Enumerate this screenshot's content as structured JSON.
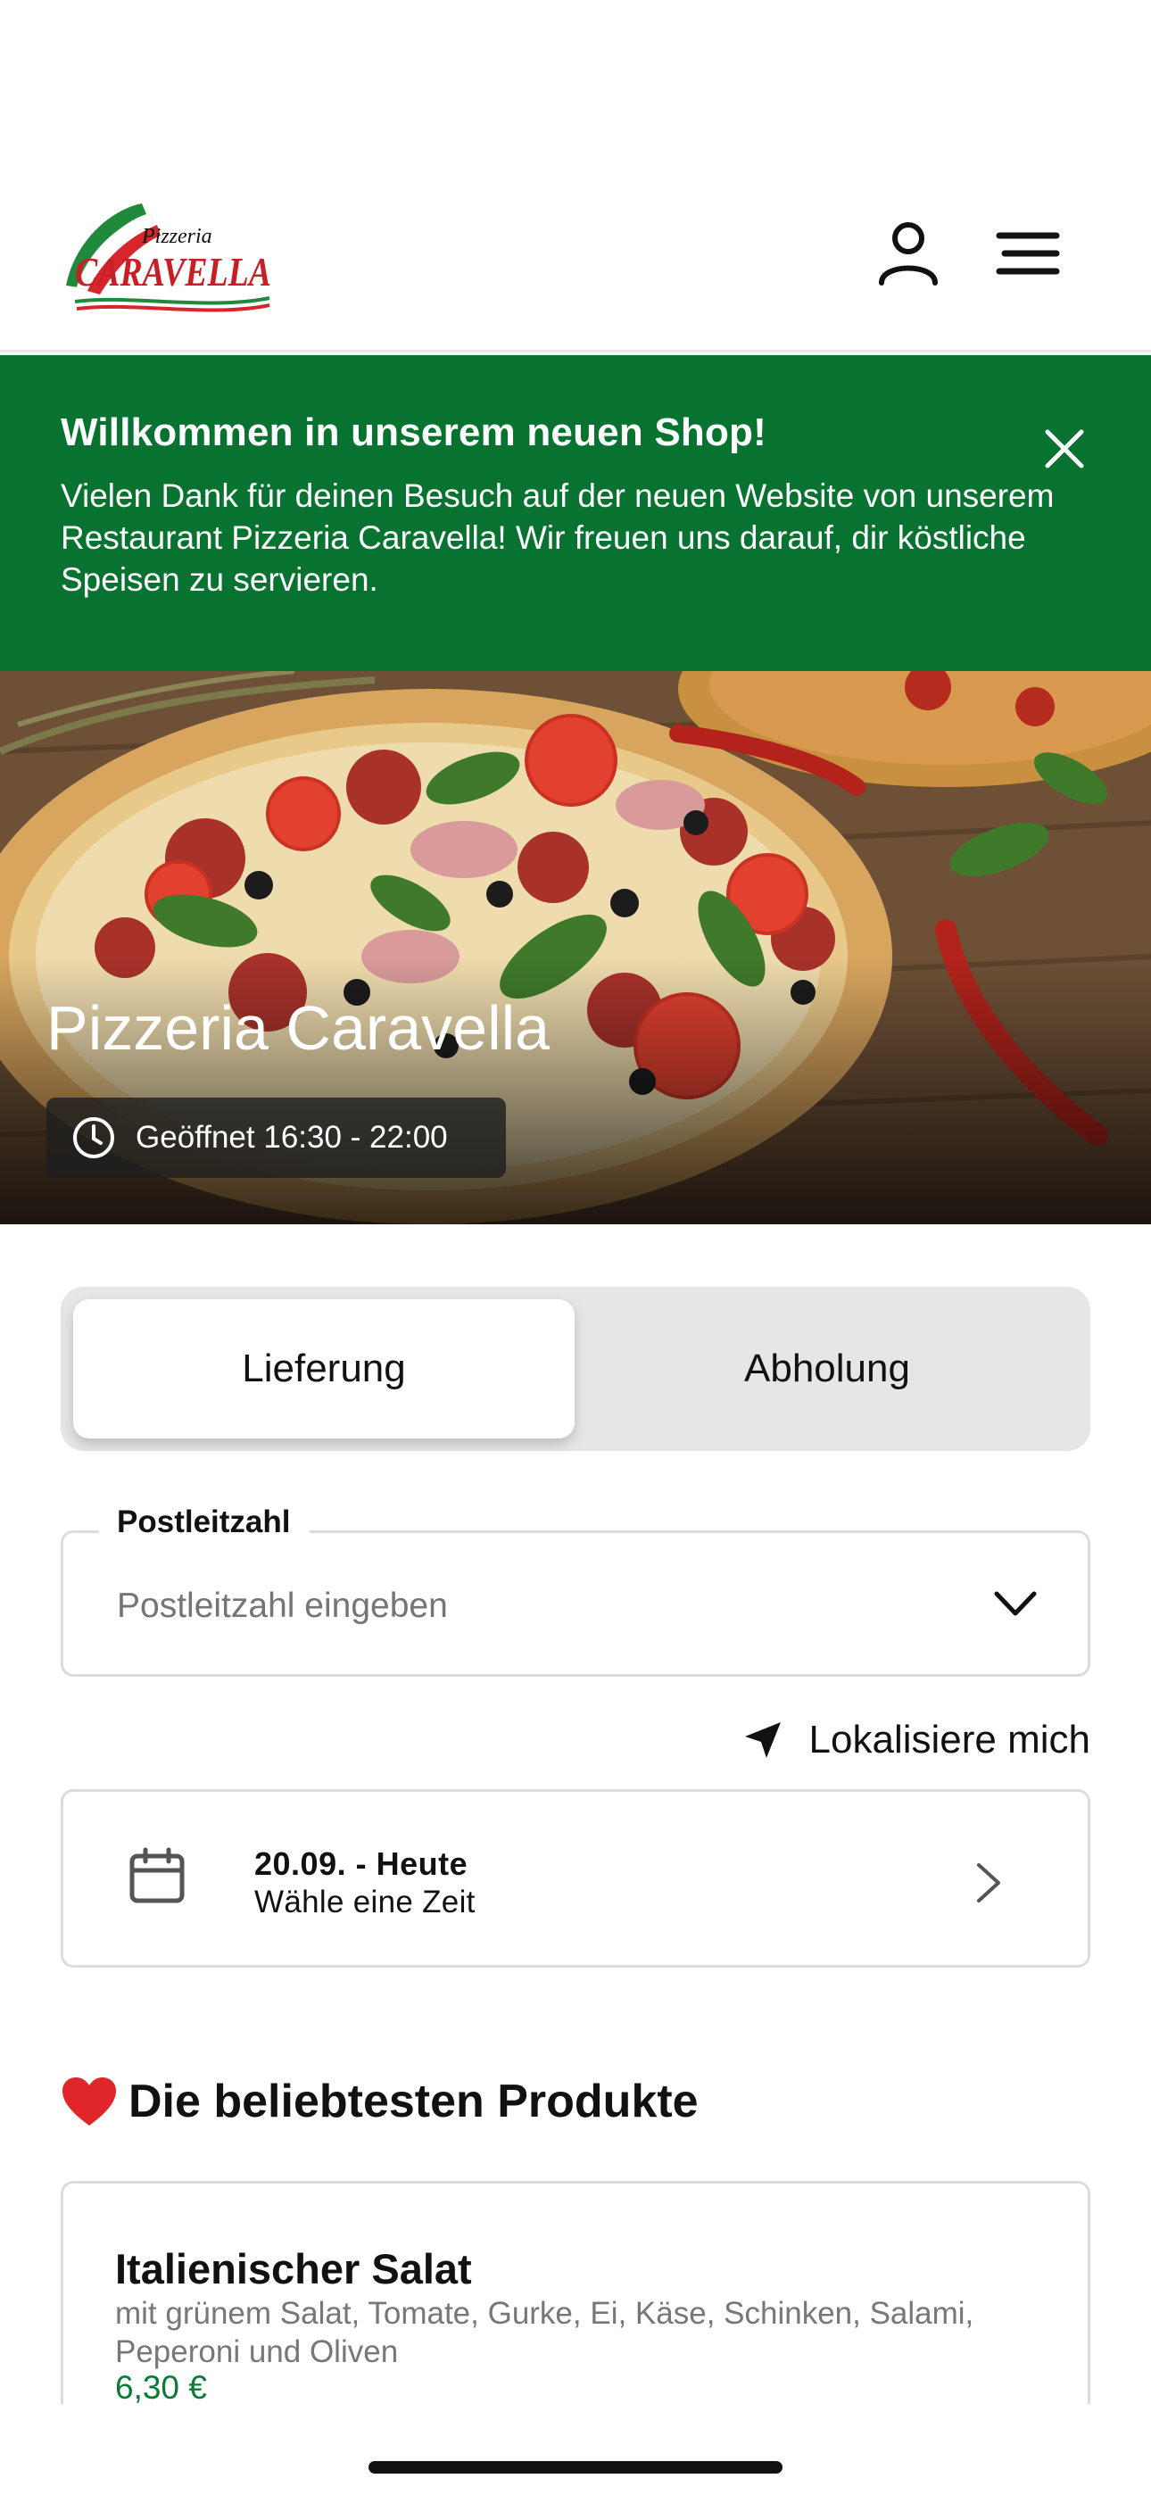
{
  "header": {
    "logo_small": "Pizzeria",
    "logo_large": "CARAVELLA",
    "icons": {
      "account": "user-icon",
      "menu": "hamburger-menu-icon"
    }
  },
  "banner": {
    "title": "Willkommen in unserem neuen Shop!",
    "text": "Vielen Dank für deinen Besuch auf der neuen Website von unserem Restaurant Pizzeria Caravella! Wir freuen uns darauf, dir köstliche Speisen zu servieren.",
    "close_icon": "close-icon",
    "background_color": "#087331"
  },
  "hero": {
    "title": "Pizzeria Caravella",
    "hours": "Geöffnet 16:30 - 22:00"
  },
  "order_mode": {
    "options": [
      "Lieferung",
      "Abholung"
    ],
    "selected": "Lieferung"
  },
  "postal": {
    "label": "Postleitzahl",
    "placeholder": "Postleitzahl eingeben",
    "value": ""
  },
  "locate": {
    "label": "Lokalisiere mich"
  },
  "date": {
    "title": "20.09. - Heute",
    "subtitle": "Wähle eine Zeit"
  },
  "popular": {
    "title": "Die beliebtesten Produkte",
    "products": [
      {
        "name": "Italienischer Salat",
        "description": "mit grünem Salat, Tomate, Gurke, Ei, Käse, Schinken, Salami, Peperoni und Oliven",
        "price": "6,30 €"
      }
    ]
  },
  "colors": {
    "brand_green": "#087331",
    "price_green": "#0b7a36",
    "heart_red": "#e0262b"
  }
}
